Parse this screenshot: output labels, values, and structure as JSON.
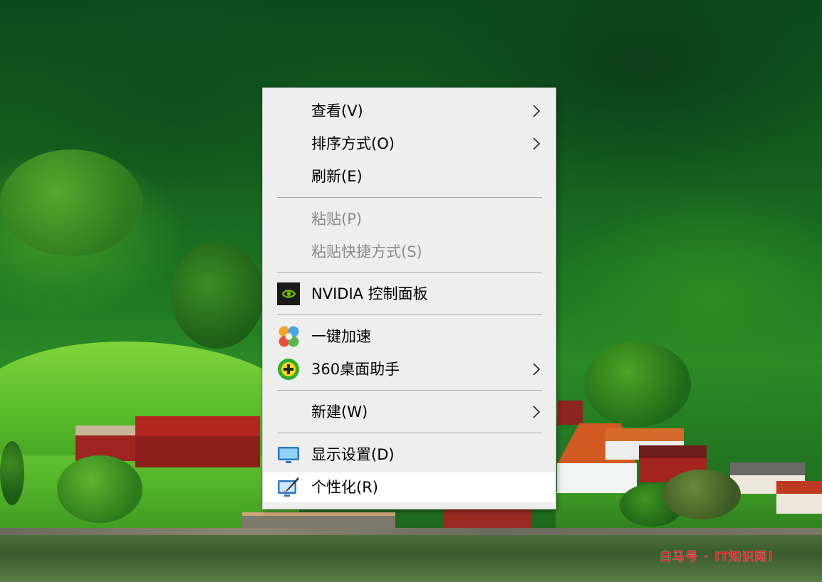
{
  "context_menu": {
    "items": [
      {
        "id": "view",
        "label": "查看(V)",
        "submenu": true,
        "enabled": true,
        "icon": null
      },
      {
        "id": "sort",
        "label": "排序方式(O)",
        "submenu": true,
        "enabled": true,
        "icon": null
      },
      {
        "id": "refresh",
        "label": "刷新(E)",
        "submenu": false,
        "enabled": true,
        "icon": null
      },
      {
        "id": "paste",
        "label": "粘贴(P)",
        "submenu": false,
        "enabled": false,
        "icon": null
      },
      {
        "id": "paste-shortcut",
        "label": "粘贴快捷方式(S)",
        "submenu": false,
        "enabled": false,
        "icon": null
      },
      {
        "id": "nvidia",
        "label": "NVIDIA 控制面板",
        "submenu": false,
        "enabled": true,
        "icon": "nvidia-icon"
      },
      {
        "id": "speedup",
        "label": "一键加速",
        "submenu": false,
        "enabled": true,
        "icon": "speedup-icon"
      },
      {
        "id": "desktop-helper",
        "label": "360桌面助手",
        "submenu": true,
        "enabled": true,
        "icon": "360-icon"
      },
      {
        "id": "new",
        "label": "新建(W)",
        "submenu": true,
        "enabled": true,
        "icon": null
      },
      {
        "id": "display-settings",
        "label": "显示设置(D)",
        "submenu": false,
        "enabled": true,
        "icon": "display-icon"
      },
      {
        "id": "personalize",
        "label": "个性化(R)",
        "submenu": false,
        "enabled": true,
        "icon": "personalize-icon",
        "highlighted": true
      }
    ]
  },
  "watermark": {
    "left": "白马号",
    "right": "IT知识网！"
  },
  "colors": {
    "menu_background": "#eeeeee",
    "highlight": "#ffffff",
    "disabled_text": "#8c8c8c",
    "watermark": "#e0252a"
  }
}
